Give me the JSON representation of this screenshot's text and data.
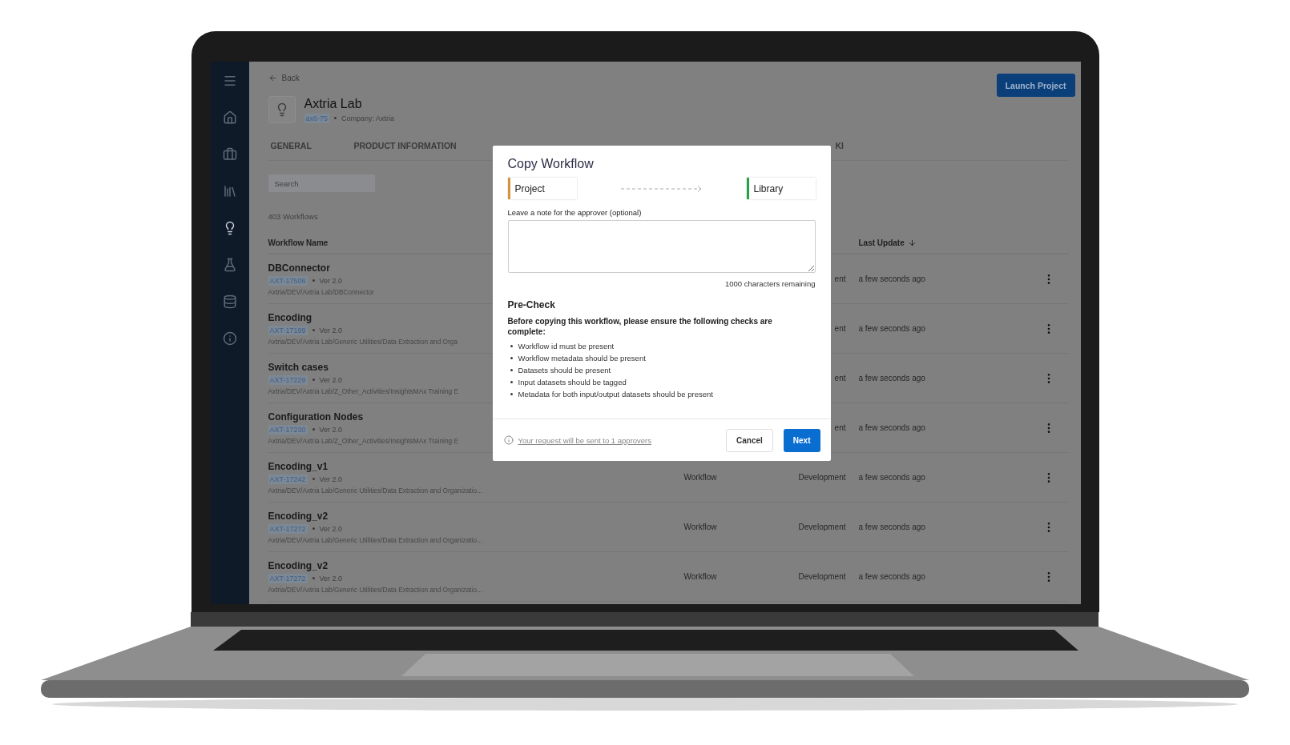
{
  "sidebar": {
    "items": [
      {
        "selected": false
      },
      {
        "selected": false
      },
      {
        "selected": false
      },
      {
        "selected": false
      },
      {
        "selected": true
      },
      {
        "selected": false
      },
      {
        "selected": false
      },
      {
        "selected": false
      }
    ]
  },
  "header": {
    "back": "Back",
    "title": "Axtria Lab",
    "project_id": "ax6-75",
    "company": "Company: Axtria",
    "launch_button": "Launch Project"
  },
  "tabs": [
    {
      "label": "GENERAL"
    },
    {
      "label": "PRODUCT INFORMATION"
    },
    {
      "label": "KI"
    }
  ],
  "search": {
    "placeholder": "Search"
  },
  "count": "403 Workflows",
  "table": {
    "columns": [
      "Workflow Name",
      "Last Update"
    ],
    "rows": [
      {
        "name": "DBConnector",
        "id": "AXT-17506",
        "version": "Ver 2.0",
        "path": "Axtria/DEV/Axtria Lab/DBConnector",
        "status": "ent",
        "updated": "a few seconds ago"
      },
      {
        "name": "Encoding",
        "id": "AXT-17199",
        "version": "Ver 2.0",
        "path": "Axtria/DEV/Axtria Lab/Generic Utilities/Data Extraction and Orga",
        "status": "ent",
        "updated": "a few seconds ago"
      },
      {
        "name": "Switch cases",
        "id": "AXT-17229",
        "version": "Ver 2.0",
        "path": "Axtria/DEV/Axtria Lab/Z_Other_Activities/InsightsMAx Training E",
        "status": "ent",
        "updated": "a few seconds ago"
      },
      {
        "name": "Configuration Nodes",
        "id": "AXT-17230",
        "version": "Ver 2.0",
        "path": "Axtria/DEV/Axtria Lab/Z_Other_Activities/InsightsMAx Training E",
        "status": "ent",
        "updated": "a few seconds ago"
      },
      {
        "name": "Encoding_v1",
        "id": "AXT-17242",
        "version": "Ver 2.0",
        "path": "Axtria/DEV/Axtria Lab/Generic Utilities/Data Extraction and Organizatio...",
        "type": "Workflow",
        "status": "Development",
        "updated": "a few seconds ago"
      },
      {
        "name": "Encoding_v2",
        "id": "AXT-17272",
        "version": "Ver 2.0",
        "path": "Axtria/DEV/Axtria Lab/Generic Utilities/Data Extraction and Organizatio...",
        "type": "Workflow",
        "status": "Development",
        "updated": "a few seconds ago"
      },
      {
        "name": "Encoding_v2",
        "id": "AXT-17272",
        "version": "Ver 2.0",
        "path": "Axtria/DEV/Axtria Lab/Generic Utilities/Data Extraction and Organizatio...",
        "type": "Workflow",
        "status": "Development",
        "updated": "a few seconds ago"
      }
    ]
  },
  "dialog": {
    "title": "Copy Workflow",
    "steps": [
      {
        "label": "Project",
        "color": "#d4953a"
      },
      {
        "label": "Library",
        "color": "#22a447"
      }
    ],
    "note_label": "Leave a note for the approver (optional)",
    "remaining": "1000 characters remaining",
    "precheck_title": "Pre-Check",
    "precheck_intro": "Before copying this workflow, please ensure the following checks are complete:",
    "checks": [
      "Workflow id must be present",
      "Workflow metadata should be present",
      "Datasets should be present",
      "Input datasets should be tagged",
      "Metadata for both input/output datasets should be present"
    ],
    "footer_link": "Your request will be sent to 1 approvers",
    "cancel": "Cancel",
    "next": "Next"
  }
}
